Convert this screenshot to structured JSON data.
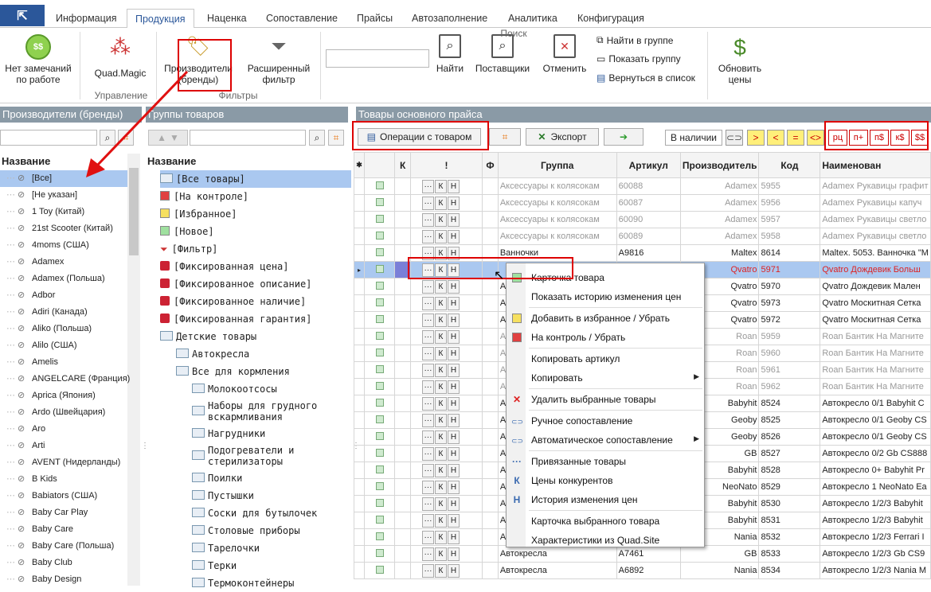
{
  "tabs": [
    "Информация",
    "Продукция",
    "Наценка",
    "Сопоставление",
    "Прайсы",
    "Автозаполнение",
    "Аналитика",
    "Конфигурация"
  ],
  "ribbon": {
    "no_remarks": "Нет замечаний\nпо работе",
    "quad_magic": "Quad.Magic",
    "group_manage": "Управление",
    "producers": "Производители\n(бренды)",
    "ext_filter": "Расширенный\nфильтр",
    "group_filters": "Фильтры",
    "find": "Найти",
    "suppliers": "Поставщики",
    "cancel": "Отменить",
    "find_in_group": "Найти в группе",
    "show_group": "Показать группу",
    "back_to_list": "Вернуться в список",
    "group_search": "Поиск",
    "update_prices": "Обновить\nцены"
  },
  "panels": {
    "brands_title": "Производители (бренды)",
    "groups_title": "Группы товаров",
    "products_title": "Товары основного прайса",
    "name_header": "Название"
  },
  "brands": [
    "[Все]",
    "[Не указан]",
    "1 Toy (Китай)",
    "21st Scooter (Китай)",
    "4moms (США)",
    "Adamex",
    "Adamex (Польша)",
    "Adbor",
    "Adiri (Канада)",
    "Aliko (Польша)",
    "Alilo (США)",
    "Amelis",
    "ANGELCARE (Франция)",
    "Aprica (Япония)",
    "Ardo (Швейцария)",
    "Aro",
    "Arti",
    "AVENT (Нидерланды)",
    "B Kids",
    "Babiators (США)",
    "Baby Car Play",
    "Baby Care",
    "Baby Care (Польша)",
    "Baby Club",
    "Baby Design"
  ],
  "groups": [
    {
      "label": "[Все товары]",
      "icon": "folder",
      "indent": 0
    },
    {
      "label": "[На контроле]",
      "icon": "red-square",
      "indent": 0
    },
    {
      "label": "[Избранное]",
      "icon": "yellow-square",
      "indent": 0
    },
    {
      "label": "[Новое]",
      "icon": "green-square",
      "indent": 0
    },
    {
      "label": "[Фильтр]",
      "icon": "filter",
      "indent": 0
    },
    {
      "label": "[Фиксированная цена]",
      "icon": "lock",
      "indent": 0
    },
    {
      "label": "[Фиксированное описание]",
      "icon": "lock",
      "indent": 0
    },
    {
      "label": "[Фиксированное наличие]",
      "icon": "lock",
      "indent": 0
    },
    {
      "label": "[Фиксированная гарантия]",
      "icon": "lock",
      "indent": 0
    },
    {
      "label": "Детские товары",
      "icon": "folder",
      "indent": 0
    },
    {
      "label": "Автокресла",
      "icon": "folder",
      "indent": 1
    },
    {
      "label": "Все для кормления",
      "icon": "folder",
      "indent": 1
    },
    {
      "label": "Молокоотсосы",
      "icon": "folder",
      "indent": 2
    },
    {
      "label": "Наборы для грудного\nвскармливания",
      "icon": "folder",
      "indent": 2
    },
    {
      "label": "Нагрудники",
      "icon": "folder",
      "indent": 2
    },
    {
      "label": "Подогреватели и\nстерилизаторы",
      "icon": "folder",
      "indent": 2
    },
    {
      "label": "Поилки",
      "icon": "folder",
      "indent": 2
    },
    {
      "label": "Пустышки",
      "icon": "folder",
      "indent": 2
    },
    {
      "label": "Соски для бутылочек",
      "icon": "folder",
      "indent": 2
    },
    {
      "label": "Столовые приборы",
      "icon": "folder",
      "indent": 2
    },
    {
      "label": "Тарелочки",
      "icon": "folder",
      "indent": 2
    },
    {
      "label": "Терки",
      "icon": "folder",
      "indent": 2
    },
    {
      "label": "Термоконтейнеры",
      "icon": "folder",
      "indent": 2
    }
  ],
  "toolbar": {
    "operations": "Операции с товаром",
    "export": "Экспорт",
    "in_stock": "В наличии",
    "y1": ">",
    "y2": "<",
    "y3": "=",
    "y4": "<>",
    "r1": "рц",
    "r2": "п+",
    "r3": "п$",
    "r4": "к$",
    "r5": "$$"
  },
  "grid": {
    "headers": [
      "К",
      "!",
      "Ф",
      "Группа",
      "Артикул",
      "Производитель",
      "Код",
      "Наименован"
    ],
    "rows": [
      {
        "group": "Аксессуары к колясокам",
        "sku": "60088",
        "maker": "Adamex",
        "code": "5955",
        "name": "Adamex Рукавицы графит",
        "style": "gray"
      },
      {
        "group": "Аксессуары к колясокам",
        "sku": "60087",
        "maker": "Adamex",
        "code": "5956",
        "name": "Adamex Рукавицы капуч",
        "style": "gray"
      },
      {
        "group": "Аксессуары к колясокам",
        "sku": "60090",
        "maker": "Adamex",
        "code": "5957",
        "name": "Adamex Рукавицы светло",
        "style": "gray"
      },
      {
        "group": "Аксессуары к колясокам",
        "sku": "60089",
        "maker": "Adamex",
        "code": "5958",
        "name": "Adamex Рукавицы светло",
        "style": "gray"
      },
      {
        "group": "Ванночки",
        "sku": "A9816",
        "maker": "Maltex",
        "code": "8614",
        "name": "Maltex. 5053. Ванночка \"М",
        "style": ""
      },
      {
        "group": "",
        "sku": "",
        "maker": "Qvatro",
        "code": "5971",
        "name": "Qvatro Дождевик Больш",
        "style": "red"
      },
      {
        "group": "А",
        "sku": "",
        "maker": "Qvatro",
        "code": "5970",
        "name": "Qvatro Дождевик Мален",
        "style": ""
      },
      {
        "group": "А",
        "sku": "",
        "maker": "Qvatro",
        "code": "5973",
        "name": "Qvatro Москитная Сетка",
        "style": ""
      },
      {
        "group": "А",
        "sku": "",
        "maker": "Qvatro",
        "code": "5972",
        "name": "Qvatro Москитная Сетка",
        "style": ""
      },
      {
        "group": "А",
        "sku": "",
        "maker": "Roan",
        "code": "5959",
        "name": "Roan Бантик На Магните",
        "style": "gray"
      },
      {
        "group": "А",
        "sku": "",
        "maker": "Roan",
        "code": "5960",
        "name": "Roan Бантик На Магните",
        "style": "gray"
      },
      {
        "group": "А",
        "sku": "",
        "maker": "Roan",
        "code": "5961",
        "name": "Roan Бантик На Магните",
        "style": "gray"
      },
      {
        "group": "А",
        "sku": "",
        "maker": "Roan",
        "code": "5962",
        "name": "Roan Бантик На Магните",
        "style": "gray"
      },
      {
        "group": "А",
        "sku": "",
        "maker": "Babyhit",
        "code": "8524",
        "name": "Автокресло 0/1 Babyhit C",
        "style": ""
      },
      {
        "group": "А",
        "sku": "",
        "maker": "Geoby",
        "code": "8525",
        "name": "Автокресло 0/1 Geoby CS",
        "style": ""
      },
      {
        "group": "А",
        "sku": "",
        "maker": "Geoby",
        "code": "8526",
        "name": "Автокресло 0/1 Geoby CS",
        "style": ""
      },
      {
        "group": "А",
        "sku": "",
        "maker": "GB",
        "code": "8527",
        "name": "Автокресло 0/2 Gb CS888",
        "style": ""
      },
      {
        "group": "А",
        "sku": "",
        "maker": "Babyhit",
        "code": "8528",
        "name": "Автокресло 0+ Babyhit Pr",
        "style": ""
      },
      {
        "group": "А",
        "sku": "",
        "maker": "NeoNato",
        "code": "8529",
        "name": "Автокресло 1 NeoNato Ea",
        "style": ""
      },
      {
        "group": "А",
        "sku": "",
        "maker": "Babyhit",
        "code": "8530",
        "name": "Автокресло 1/2/3 Babyhit",
        "style": ""
      },
      {
        "group": "А",
        "sku": "",
        "maker": "Babyhit",
        "code": "8531",
        "name": "Автокресло 1/2/3 Babyhit",
        "style": ""
      },
      {
        "group": "А",
        "sku": "",
        "maker": "Nania",
        "code": "8532",
        "name": "Автокресло 1/2/3 Ferrari I",
        "style": ""
      },
      {
        "group": "Автокресла",
        "sku": "A7461",
        "maker": "GB",
        "code": "8533",
        "name": "Автокресло 1/2/3 Gb CS9",
        "style": ""
      },
      {
        "group": "Автокресла",
        "sku": "A6892",
        "maker": "Nania",
        "code": "8534",
        "name": "Автокресло 1/2/3 Nania M",
        "style": ""
      }
    ],
    "mini_k": "К",
    "mini_h": "Н",
    "mini_dots": "···"
  },
  "context_menu": [
    {
      "label": "Карточка товара",
      "icon": "green-square"
    },
    {
      "label": "Показать историю изменения цен",
      "icon": ""
    },
    {
      "label": "Добавить в избранное / Убрать",
      "icon": "yellow-square"
    },
    {
      "label": "На контроль / Убрать",
      "icon": "red-square"
    },
    {
      "label": "Копировать артикул",
      "icon": ""
    },
    {
      "label": "Копировать",
      "icon": "",
      "sub": true
    },
    {
      "label": "Удалить выбранные товары",
      "icon": "red-x"
    },
    {
      "label": "Ручное сопоставление",
      "icon": "link"
    },
    {
      "label": "Автоматическое сопоставление",
      "icon": "link",
      "sub": true
    },
    {
      "label": "Привязанные товары",
      "icon": "dots"
    },
    {
      "label": "Цены конкурентов",
      "icon": "k"
    },
    {
      "label": "История изменения цен",
      "icon": "h"
    },
    {
      "label": "Карточка выбранного товара",
      "icon": ""
    },
    {
      "label": "Характеристики из Quad.Site",
      "icon": ""
    }
  ],
  "colors": {
    "accent": "#2b579a",
    "panel_header": "#8a9aa6",
    "selection": "#aac8f0",
    "highlight_red": "#dd0000"
  }
}
